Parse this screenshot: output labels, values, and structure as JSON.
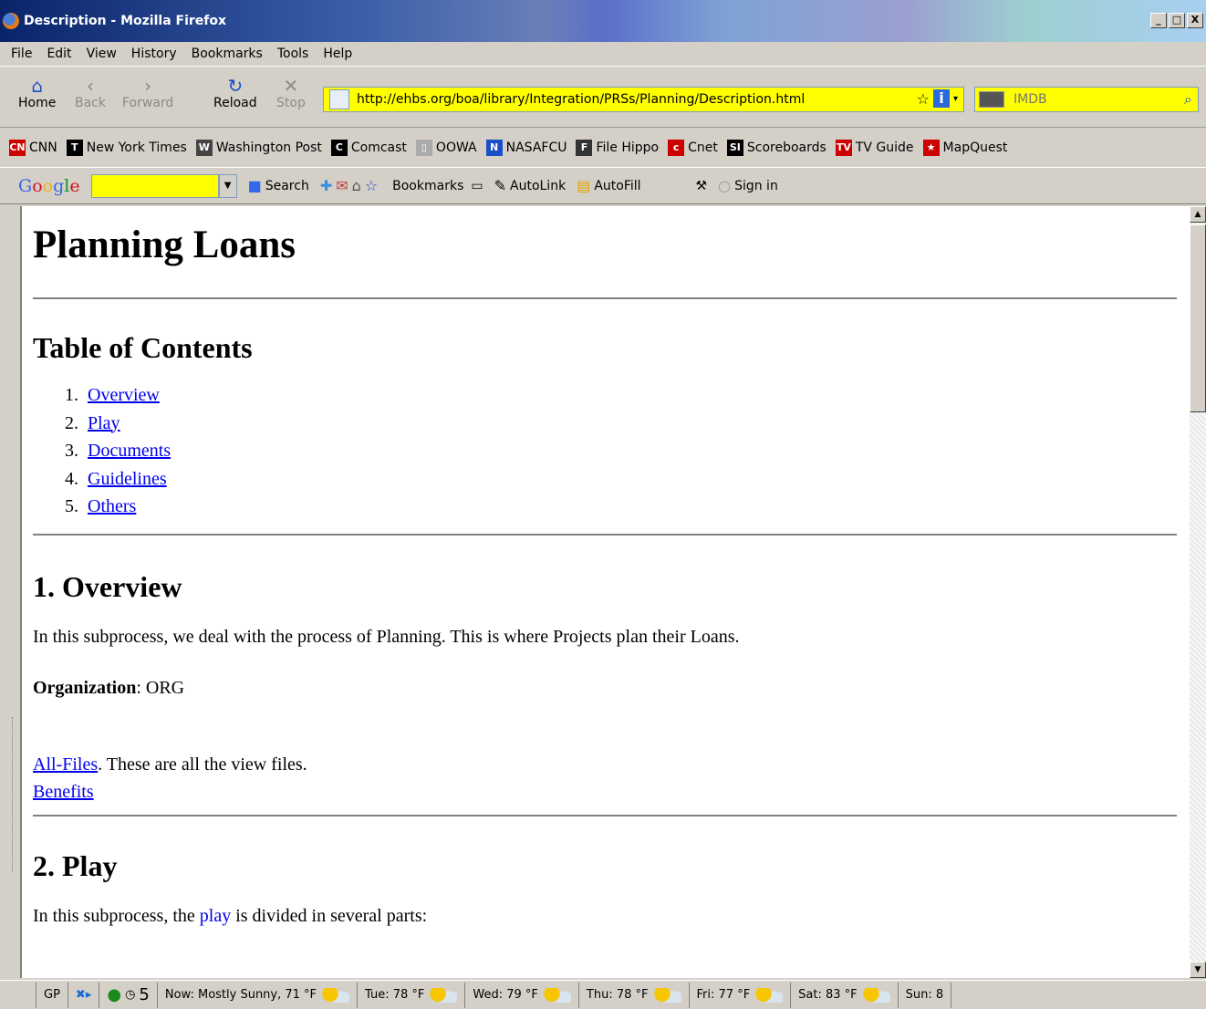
{
  "window": {
    "title": "Description - Mozilla Firefox",
    "controls": [
      "_",
      "□",
      "X"
    ]
  },
  "menu": [
    "File",
    "Edit",
    "View",
    "History",
    "Bookmarks",
    "Tools",
    "Help"
  ],
  "nav": {
    "home": "Home",
    "back": "Back",
    "forward": "Forward",
    "reload": "Reload",
    "stop": "Stop",
    "url": "http://ehbs.org/boa/library/Integration/PRSs/Planning/Description.html",
    "search_placeholder": "IMDB"
  },
  "bookmarks": [
    {
      "icon": "CN",
      "label": "CNN",
      "color": "#cc0000"
    },
    {
      "icon": "T",
      "label": "New York Times",
      "color": "#000000"
    },
    {
      "icon": "W",
      "label": "Washington Post",
      "color": "#444444"
    },
    {
      "icon": "C",
      "label": "Comcast",
      "color": "#000000"
    },
    {
      "icon": "▯",
      "label": "OOWA",
      "color": "#aaaaaa"
    },
    {
      "icon": "N",
      "label": "NASAFCU",
      "color": "#1a4fc8"
    },
    {
      "icon": "F",
      "label": "File Hippo",
      "color": "#333333"
    },
    {
      "icon": "c",
      "label": "Cnet",
      "color": "#cc0000"
    },
    {
      "icon": "SI",
      "label": "Scoreboards",
      "color": "#000000"
    },
    {
      "icon": "TV",
      "label": "TV Guide",
      "color": "#cc0000"
    },
    {
      "icon": "★",
      "label": "MapQuest",
      "color": "#cc0000"
    }
  ],
  "googlebar": {
    "search": "Search",
    "bookmarks": "Bookmarks",
    "autolink": "AutoLink",
    "autofill": "AutoFill",
    "signin": "Sign in"
  },
  "page": {
    "title": "Planning Loans",
    "toc_heading": "Table of Contents",
    "toc": [
      {
        "num": "1.",
        "label": "Overview"
      },
      {
        "num": "2.",
        "label": "Play"
      },
      {
        "num": "3.",
        "label": "Documents"
      },
      {
        "num": "4.",
        "label": "Guidelines"
      },
      {
        "num": "5.",
        "label": "Others"
      }
    ],
    "overview_heading": "1. Overview",
    "overview_text": "In this subprocess, we deal with the process of Planning. This is where Projects plan their Loans.",
    "org_label": "Organization",
    "org_value": ": ORG",
    "allfiles_link": "All-Files",
    "allfiles_text": ". These are all the view files.",
    "benefits_link": "Benefits",
    "play_heading": "2. Play",
    "play_text_before": "In this subprocess, the ",
    "play_link": "play",
    "play_text_after": " is divided in several parts:"
  },
  "status": {
    "gp": "GP",
    "count": "5",
    "weather": [
      "Now: Mostly Sunny, 71 °F",
      "Tue: 78 °F",
      "Wed: 79 °F",
      "Thu: 78 °F",
      "Fri: 77 °F",
      "Sat: 83 °F",
      "Sun: 8"
    ]
  }
}
